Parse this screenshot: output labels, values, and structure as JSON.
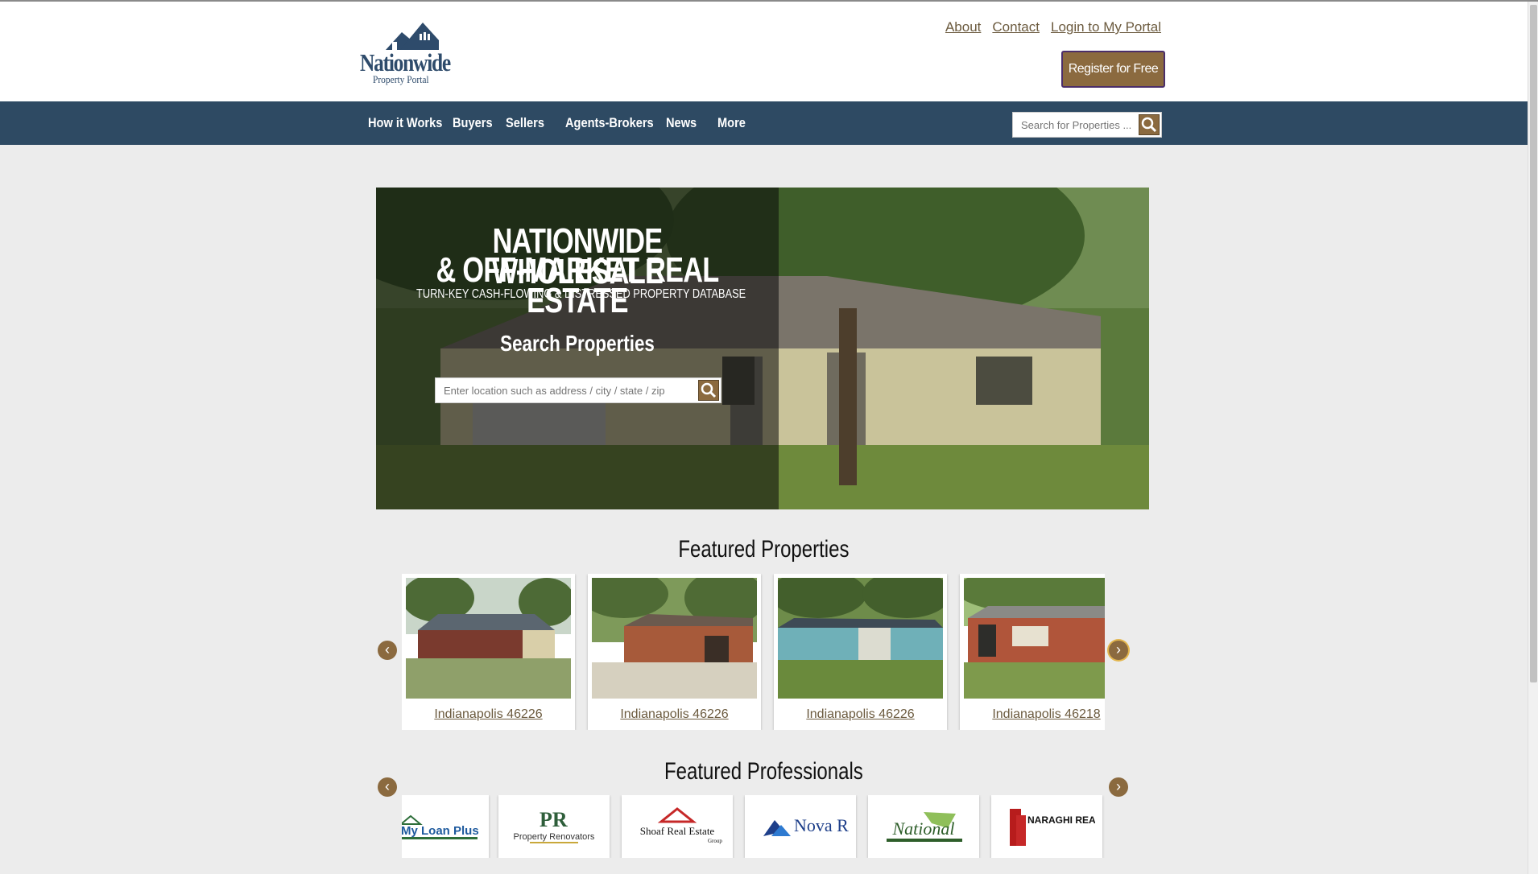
{
  "brand": {
    "logo_word": "Nationwide",
    "logo_sub": "Property Portal"
  },
  "top_links": [
    "About",
    "Contact",
    "Login to My Portal"
  ],
  "register_label": "Register for Free",
  "nav": {
    "items": [
      "How it Works",
      "Buyers",
      "Sellers",
      "Agents-Brokers",
      "News",
      "More"
    ],
    "search_placeholder": "Search for Properties ..."
  },
  "hero": {
    "title_line1": "NATIONWIDE WHOLESALE",
    "title_line2": "& OFF-MARKET REAL ESTATE",
    "subtitle": "TURN-KEY CASH-FLOWING & DISTRESSED PROPERTY DATABASE",
    "search_label": "Search Properties",
    "search_placeholder": "Enter location such as address / city / state / zip"
  },
  "featured_properties": {
    "title": "Featured Properties",
    "items": [
      {
        "caption": "Indianapolis 46226"
      },
      {
        "caption": "Indianapolis 46226"
      },
      {
        "caption": "Indianapolis 46226"
      },
      {
        "caption": "Indianapolis 46218"
      }
    ]
  },
  "featured_professionals": {
    "title": "Featured Professionals",
    "logos": [
      {
        "name": "My Loan Plus"
      },
      {
        "name": "Property Renovators"
      },
      {
        "name": "Shoaf Real Estate"
      },
      {
        "name": "Nova Realty Group"
      },
      {
        "name": "National"
      },
      {
        "name": "NARAGHI REAL ESTATE"
      }
    ]
  },
  "arrows": {
    "prev": "‹",
    "next": "›"
  },
  "colors": {
    "nav_bg": "#2e4a63",
    "accent": "#8b6a3f",
    "link": "#6b5a3e",
    "page_bg": "#ececec"
  }
}
